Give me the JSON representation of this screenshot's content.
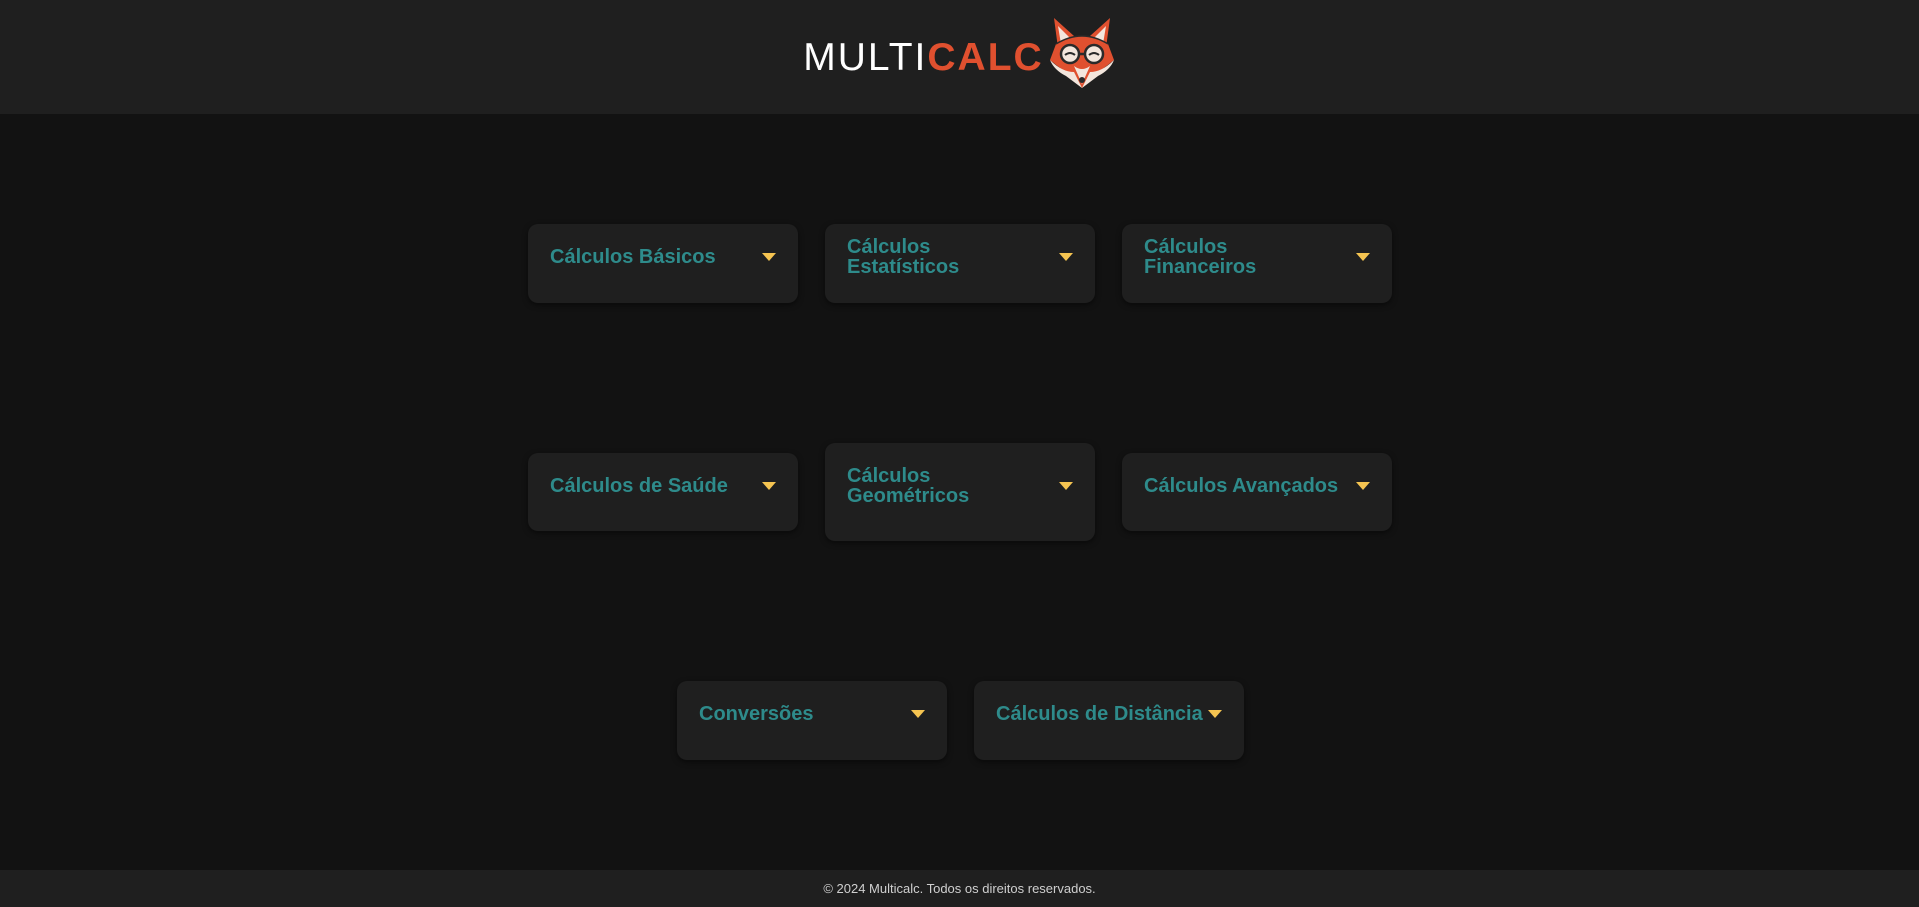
{
  "header": {
    "logo_multi": "MULTI",
    "logo_calc": "CALC",
    "mascot_icon": "fox-with-glasses-icon"
  },
  "categories": [
    {
      "label": "Cálculos Básicos",
      "icon": "caret-down-icon"
    },
    {
      "label": "Cálculos Estatísticos",
      "icon": "caret-down-icon"
    },
    {
      "label": "Cálculos Financeiros",
      "icon": "caret-down-icon"
    },
    {
      "label": "Cálculos de Saúde",
      "icon": "caret-down-icon"
    },
    {
      "label": "Cálculos Geométricos",
      "icon": "caret-down-icon"
    },
    {
      "label": "Cálculos Avançados",
      "icon": "caret-down-icon"
    },
    {
      "label": "Conversões",
      "icon": "caret-down-icon"
    },
    {
      "label": "Cálculos de Distância",
      "icon": "caret-down-icon"
    }
  ],
  "footer": {
    "copyright": "© 2024 Multicalc. Todos os direitos reservados."
  },
  "colors": {
    "header_bg": "#1f1f1f",
    "page_bg": "#121212",
    "card_bg": "#1f1f1f",
    "card_text": "#2e8b8b",
    "caret": "#f5c451",
    "brand_accent": "#e0502f"
  }
}
